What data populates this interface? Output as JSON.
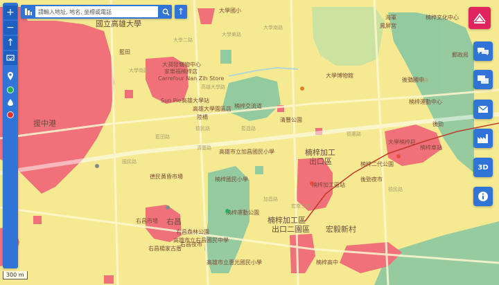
{
  "search": {
    "placeholder": "請輸入地址, 地名, 坐標或電話"
  },
  "scale": "300 m",
  "right_buttons": {
    "threed_label": "3D"
  },
  "icons": {
    "zoom_in": "plus-icon",
    "zoom_out": "minus-icon",
    "locate": "arrow-up-icon",
    "layers": "layers-icon",
    "marker": "map-marker-icon",
    "green_dot": "green-circle-icon",
    "droplet": "water-drop-icon",
    "red_dot": "red-circle-icon",
    "logo": "brand-logo-icon",
    "map_tools": "map-tools-icon",
    "chat": "chat-bubbles-icon",
    "mail": "mail-icon",
    "factory": "factory-icon",
    "info": "info-icon"
  },
  "colors": {
    "yellow_zone": "#f5ea92",
    "red_zone": "#f0717a",
    "green_zone": "#8fc9a0",
    "toolbar_blue": "#2f74d6",
    "logo_pink": "#e0245e",
    "dot_green": "#22b14c",
    "dot_red": "#e03030"
  },
  "map": {
    "labels": [
      {
        "text": "國立高雄大學",
        "cls": "big"
      },
      {
        "text": "藍田"
      },
      {
        "text": "大學國小"
      },
      {
        "text": "大學二路"
      },
      {
        "text": "大學東路"
      },
      {
        "text": "大學南路"
      },
      {
        "text": "大潤發購物中心"
      },
      {
        "text": "大學南路"
      },
      {
        "text": "家樂福楠梓店"
      },
      {
        "text": "Carrefour Nan Zih Store"
      },
      {
        "text": "高雄大學路"
      },
      {
        "text": "高雄大學站"
      },
      {
        "text": "Sun Pie"
      },
      {
        "text": "高雄大學園區店"
      },
      {
        "text": "楠梓交流道"
      },
      {
        "text": "陸橋"
      },
      {
        "text": "藍昌路"
      },
      {
        "text": "藍田路"
      },
      {
        "text": "德民路"
      },
      {
        "text": "國民路"
      },
      {
        "text": "德民黃昏市場"
      },
      {
        "text": "清豐路"
      },
      {
        "text": "高雄市立加昌國民小學"
      },
      {
        "text": "楠梓加工"
      },
      {
        "text": "出口區"
      },
      {
        "text": "楠梓加工區站"
      },
      {
        "text": "楠梓運動公園"
      },
      {
        "text": "楠梓國民小學"
      },
      {
        "text": "右昌市場"
      },
      {
        "text": "右昌",
        "cls": "big"
      },
      {
        "text": "右昌森林公園"
      },
      {
        "text": "楠梓加工區"
      },
      {
        "text": "出口二園區"
      },
      {
        "text": "宏毅新村"
      },
      {
        "text": "右昌楊家古厝"
      },
      {
        "text": "高雄市立右昌國民中學"
      },
      {
        "text": "高雄市立惠光國民小學"
      },
      {
        "text": "楠梓高中"
      },
      {
        "text": "楠梓二代公園"
      },
      {
        "text": "大學博物館"
      },
      {
        "text": "楠梓運動中心"
      },
      {
        "text": "高楠公路"
      },
      {
        "text": "德惠路"
      },
      {
        "text": "德民路"
      },
      {
        "text": "援中港"
      },
      {
        "text": "後勁"
      },
      {
        "text": "後勁夜市"
      },
      {
        "text": "後勁國中"
      },
      {
        "text": "大學楠梓莊"
      },
      {
        "text": "郵政局"
      },
      {
        "text": "楠梓文化中心"
      },
      {
        "text": "海軍"
      },
      {
        "text": "鳳屏宮"
      },
      {
        "text": "楠梓車站"
      },
      {
        "text": "清豐公園"
      },
      {
        "text": "右昌夜市"
      },
      {
        "text": "宏南三路"
      },
      {
        "text": "加昌路"
      }
    ]
  }
}
